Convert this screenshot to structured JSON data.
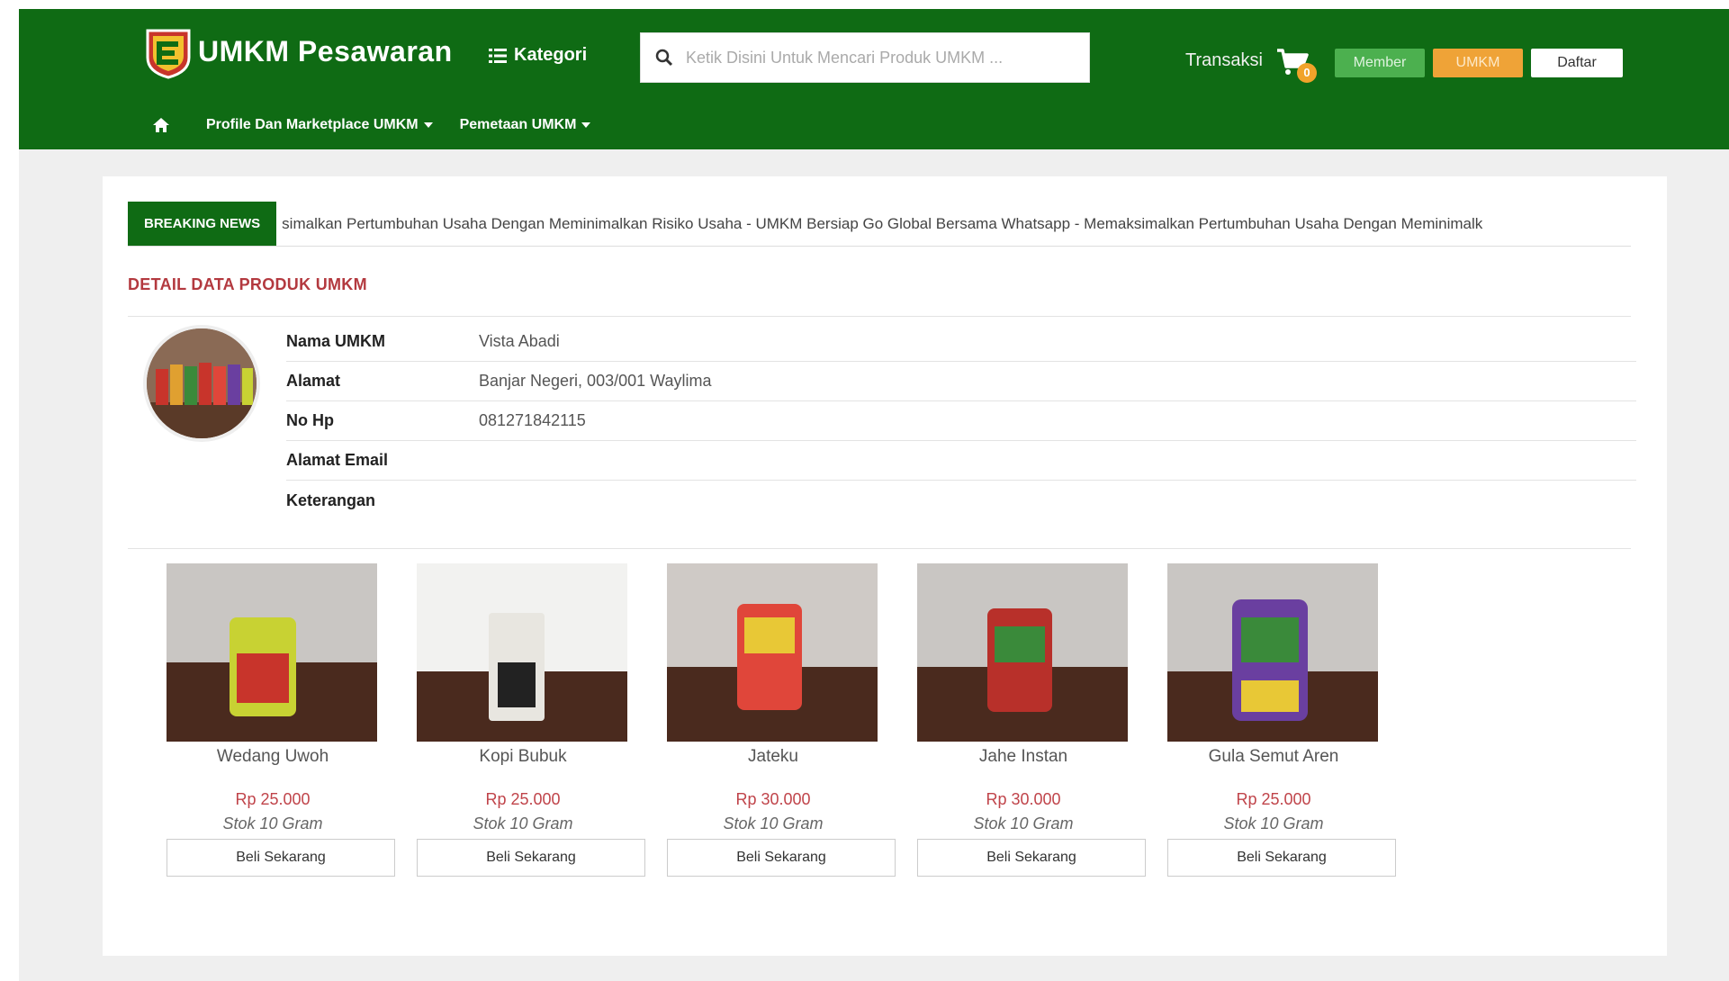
{
  "header": {
    "brand": "UMKM Pesawaran",
    "kategori_label": "Kategori",
    "search_placeholder": "Ketik Disini Untuk Mencari Produk UMKM ...",
    "transaksi_label": "Transaksi",
    "cart_count": "0",
    "member_label": "Member",
    "umkm_label": "UMKM",
    "daftar_label": "Daftar",
    "colors": {
      "header_bg": "#0f6b14",
      "member": "#4cb04f",
      "umkm": "#efa337",
      "badge": "#f1a32a"
    }
  },
  "nav": {
    "items": [
      {
        "label": "Profile Dan Marketplace UMKM"
      },
      {
        "label": "Pemetaan UMKM"
      }
    ]
  },
  "ticker": {
    "label": "BREAKING NEWS",
    "text": "simalkan Pertumbuhan Usaha Dengan Meminimalkan Risiko Usaha  -  UMKM Bersiap Go Global Bersama Whatsapp  -  Memaksimalkan Pertumbuhan Usaha Dengan Meminimalk"
  },
  "detail": {
    "title": "DETAIL DATA PRODUK UMKM",
    "rows": [
      {
        "label": "Nama UMKM",
        "value": "Vista Abadi"
      },
      {
        "label": "Alamat",
        "value": "Banjar Negeri, 003/001 Waylima"
      },
      {
        "label": "No Hp",
        "value": "081271842115"
      },
      {
        "label": "Alamat Email",
        "value": ""
      },
      {
        "label": "Keterangan",
        "value": ""
      }
    ]
  },
  "products": [
    {
      "name": "Wedang Uwoh",
      "price": "Rp 25.000",
      "stock": "Stok 10 Gram",
      "buy_label": "Beli Sekarang",
      "pack_color": "#c8d233"
    },
    {
      "name": "Kopi Bubuk",
      "price": "Rp 25.000",
      "stock": "Stok 10 Gram",
      "buy_label": "Beli Sekarang",
      "pack_color": "#e8e6e0"
    },
    {
      "name": "Jateku",
      "price": "Rp 30.000",
      "stock": "Stok 10 Gram",
      "buy_label": "Beli Sekarang",
      "pack_color": "#e0463a"
    },
    {
      "name": "Jahe Instan",
      "price": "Rp 30.000",
      "stock": "Stok 10 Gram",
      "buy_label": "Beli Sekarang",
      "pack_color": "#b8302a"
    },
    {
      "name": "Gula Semut Aren",
      "price": "Rp 25.000",
      "stock": "Stok 10 Gram",
      "buy_label": "Beli Sekarang",
      "pack_color": "#6a3fa0"
    }
  ]
}
